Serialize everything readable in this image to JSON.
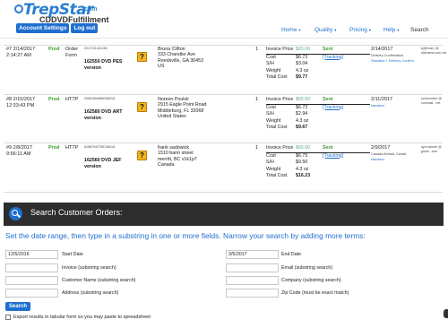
{
  "header": {
    "logo_text": "TrepStar",
    "logo_suffix": ".com",
    "logo_sub": "CDDVDFulfillment",
    "buttons": [
      "Account Settings",
      "Log out"
    ]
  },
  "nav": {
    "items": [
      {
        "label": "Home",
        "dropdown": true
      },
      {
        "label": "Quality",
        "dropdown": true
      },
      {
        "label": "Pricing",
        "dropdown": true
      },
      {
        "label": "Help",
        "dropdown": true
      },
      {
        "label": "Search",
        "dropdown": false
      }
    ]
  },
  "orders": [
    {
      "date": "#7 2/14/2017",
      "time": "2:14:27 AM",
      "prod": "Prod",
      "type_line1": "Order",
      "type_line2": "Form",
      "code": "2017211421156",
      "title": "162550 DVD PES version",
      "addr": [
        "Bruna Clifton",
        "333 Chandler Ave",
        "Reedsville, GA 30453",
        "US"
      ],
      "qty": "1",
      "invoice_label": "Invoice Price",
      "invoice_value": "$65.00",
      "sent": "Sent",
      "tracking": "[Tracking]",
      "cost": "$6.73",
      "sh": "$3.04",
      "weight": "4.3 oz",
      "total": "$9.77",
      "ship_date": "2/14/2017",
      "ship_line2": "Delivery Confirmation",
      "ship_method": "Standard + Delivery Confirm",
      "user": "ty@host | @ sitename.com net"
    },
    {
      "date": "#8 2/10/2017",
      "time": "12:33:43 PM",
      "prod": "Prod",
      "type_line1": "HTTP",
      "type_line2": "",
      "code": "2008166468630801A",
      "title": "162580 DVD ART version",
      "addr": [
        "Noreen Poulsir",
        "2915 Eagle Point Road",
        "Middleburg, FL 32068",
        "United States"
      ],
      "qty": "1",
      "invoice_label": "Invoice Price",
      "invoice_value": "$65.00",
      "sent": "Sent",
      "tracking": "[Tracking]",
      "cost": "$6.73",
      "sh": "$2.94",
      "weight": "4.3 oz",
      "total": "$9.67",
      "ship_date": "2/11/2017",
      "ship_line2": "",
      "ship_method": "standard",
      "user": "someonline @ comcast . net"
    },
    {
      "date": "#9 2/8/2017",
      "time": "9:56:11 AM",
      "prod": "Prod",
      "type_line1": "HTTP",
      "type_line2": "",
      "code": "8156794275574841A",
      "title": "162560 DVD JEF version",
      "addr": [
        "frank sadowick",
        "1510 bann street",
        "merritt, BC v1k1p7",
        "Canada"
      ],
      "qty": "1",
      "invoice_label": "Invoice Price",
      "invoice_value": "$65.00",
      "sent": "Sent",
      "tracking": "[Tracking]",
      "cost": "$6.73",
      "sh": "$9.50",
      "weight": "4.3 oz",
      "total": "$16.23",
      "ship_date": "2/9/2017",
      "ship_line2": "Canada Airmail, Canad",
      "ship_method": "standard",
      "user": "sym.winner @ gmail . com"
    }
  ],
  "price_labels": {
    "cost": "Cost",
    "sh": "S/H",
    "weight": "Weight",
    "total": "Total Cost"
  },
  "search": {
    "title": "Search Customer Orders:",
    "intro": "Set the date range, then type in a substring in one or more fields. Narrow your search by adding more terms:",
    "start_date_value": "12/5/2016",
    "start_date_label": "Start Date",
    "end_date_value": "3/5/2017",
    "end_date_label": "End Date",
    "invoice_label": "Invoice (substring search)",
    "email_label": "Email (substring search)",
    "customer_label": "Customer Name (substring search)",
    "company_label": "Company (substring search)",
    "address_label": "Address (substring search)",
    "zip_label": "Zip Code (must be exact match)",
    "button": "Search",
    "export_label": "Export results in tabular form so you may paste to spreadsheet"
  },
  "colors": {
    "accent": "#1e6fcf",
    "prod": "#3f9b2f",
    "panel": "#2d2d2d",
    "help": "#f2b520"
  }
}
